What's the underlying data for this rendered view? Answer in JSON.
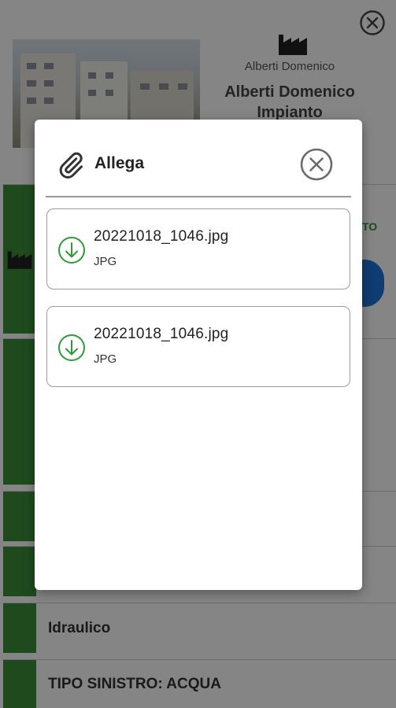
{
  "background": {
    "company_name_small": "Alberti Domenico",
    "company_title": "Alberti Domenico Impianto",
    "side_label": "TO",
    "rows": [
      {
        "label": "Idraulico"
      },
      {
        "label": "TIPO SINISTRO: ACQUA"
      }
    ]
  },
  "dialog": {
    "title": "Allega",
    "files": [
      {
        "name": "20221018_1046.jpg",
        "type": "JPG"
      },
      {
        "name": "20221018_1046.jpg",
        "type": "JPG"
      }
    ]
  },
  "colors": {
    "accent_green": "#3c8f3a",
    "download_icon": "#2e9a37",
    "fab_blue": "#1e74d8"
  },
  "icons": {
    "attach": "paperclip-icon",
    "close": "close-circle-icon",
    "download": "download-circle-icon",
    "company": "factory-icon"
  }
}
